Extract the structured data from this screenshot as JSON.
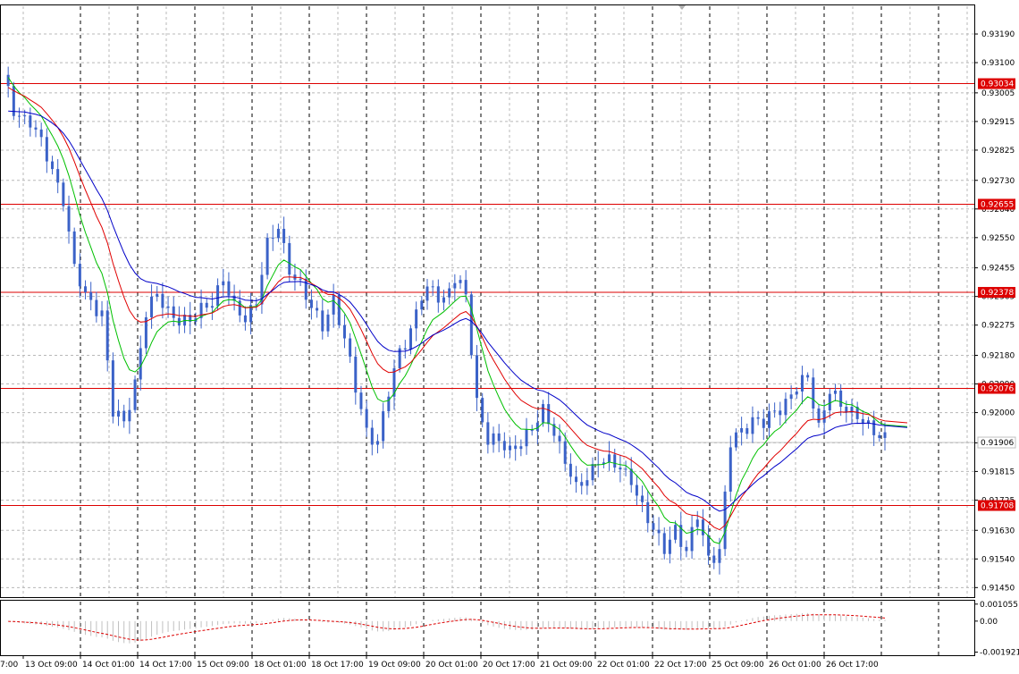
{
  "chart_data": {
    "type": "candlestick",
    "title": "",
    "price_axis": {
      "ylim": [
        0.9142,
        0.9328
      ],
      "ticks": [
        "0.93190",
        "0.93100",
        "0.93005",
        "0.92915",
        "0.92825",
        "0.92730",
        "0.92640",
        "0.92550",
        "0.92455",
        "0.92365",
        "0.92275",
        "0.92180",
        "0.92090",
        "0.92000",
        "0.91905",
        "0.91815",
        "0.91725",
        "0.91630",
        "0.91540",
        "0.91450"
      ]
    },
    "time_axis": {
      "labels": [
        "13 Oct 09:00",
        "14 Oct 01:00",
        "14 Oct 17:00",
        "15 Oct 09:00",
        "18 Oct 01:00",
        "18 Oct 17:00",
        "19 Oct 09:00",
        "20 Oct 01:00",
        "20 Oct 17:00",
        "21 Oct 09:00",
        "22 Oct 01:00",
        "22 Oct 17:00",
        "25 Oct 09:00",
        "26 Oct 01:00",
        "26 Oct 17:00"
      ],
      "first_partial_label": "7:00"
    },
    "horizontal_levels": [
      {
        "label": "0.93034",
        "value": 0.93034
      },
      {
        "label": "0.92655",
        "value": 0.92655
      },
      {
        "label": "0.92378",
        "value": 0.92378
      },
      {
        "label": "0.92076",
        "value": 0.92076
      },
      {
        "label": "0.91708",
        "value": 0.91708
      }
    ],
    "current_price": {
      "label": "0.91906",
      "value": 0.91906
    },
    "close_path": [
      [
        0,
        0.9305
      ],
      [
        2,
        0.9295
      ],
      [
        5,
        0.9292
      ],
      [
        8,
        0.928
      ],
      [
        11,
        0.9268
      ],
      [
        13,
        0.9245
      ],
      [
        15,
        0.9236
      ],
      [
        18,
        0.9232
      ],
      [
        20,
        0.92
      ],
      [
        22,
        0.9196
      ],
      [
        24,
        0.921
      ],
      [
        26,
        0.9232
      ],
      [
        28,
        0.9236
      ],
      [
        30,
        0.9232
      ],
      [
        32,
        0.923
      ],
      [
        34,
        0.9228
      ],
      [
        36,
        0.9232
      ],
      [
        38,
        0.9236
      ],
      [
        40,
        0.9242
      ],
      [
        42,
        0.9232
      ],
      [
        44,
        0.923
      ],
      [
        46,
        0.9236
      ],
      [
        48,
        0.9252
      ],
      [
        50,
        0.9258
      ],
      [
        52,
        0.9246
      ],
      [
        54,
        0.924
      ],
      [
        56,
        0.9232
      ],
      [
        58,
        0.9228
      ],
      [
        60,
        0.9236
      ],
      [
        62,
        0.9222
      ],
      [
        64,
        0.9208
      ],
      [
        66,
        0.9195
      ],
      [
        68,
        0.919
      ],
      [
        70,
        0.9206
      ],
      [
        72,
        0.922
      ],
      [
        74,
        0.9226
      ],
      [
        76,
        0.9236
      ],
      [
        78,
        0.9239
      ],
      [
        80,
        0.9236
      ],
      [
        82,
        0.9242
      ],
      [
        84,
        0.9236
      ],
      [
        86,
        0.9204
      ],
      [
        88,
        0.9192
      ],
      [
        90,
        0.919
      ],
      [
        92,
        0.9188
      ],
      [
        94,
        0.9192
      ],
      [
        96,
        0.9194
      ],
      [
        98,
        0.92
      ],
      [
        100,
        0.9195
      ],
      [
        102,
        0.9185
      ],
      [
        104,
        0.9175
      ],
      [
        106,
        0.918
      ],
      [
        108,
        0.9186
      ],
      [
        110,
        0.9184
      ],
      [
        112,
        0.9182
      ],
      [
        114,
        0.918
      ],
      [
        116,
        0.917
      ],
      [
        118,
        0.9162
      ],
      [
        120,
        0.9158
      ],
      [
        122,
        0.9164
      ],
      [
        124,
        0.9155
      ],
      [
        126,
        0.9168
      ],
      [
        128,
        0.9155
      ],
      [
        130,
        0.9156
      ],
      [
        132,
        0.919
      ],
      [
        134,
        0.9195
      ],
      [
        136,
        0.9198
      ],
      [
        138,
        0.9196
      ],
      [
        140,
        0.92
      ],
      [
        142,
        0.9204
      ],
      [
        144,
        0.9208
      ],
      [
        146,
        0.921
      ],
      [
        148,
        0.9196
      ],
      [
        150,
        0.9208
      ],
      [
        152,
        0.9201
      ],
      [
        154,
        0.92
      ],
      [
        156,
        0.9199
      ],
      [
        158,
        0.9193
      ],
      [
        160,
        0.9191
      ]
    ],
    "moving_averages": [
      {
        "color": "#00c000",
        "period": 8
      },
      {
        "color": "#e00000",
        "period": 16
      },
      {
        "color": "#0000c8",
        "period": 26
      }
    ],
    "oscillator": {
      "ticks": [
        "0.001055",
        "0.00",
        "-0.001921"
      ],
      "ylim": [
        -0.00195,
        0.0011
      ]
    },
    "colors": {
      "candle": "#3b62c8",
      "level": "#dd0000",
      "level_tag": "#dd0000",
      "grid": "#b8b8b8",
      "current_tag": "#d8d8d8"
    }
  }
}
